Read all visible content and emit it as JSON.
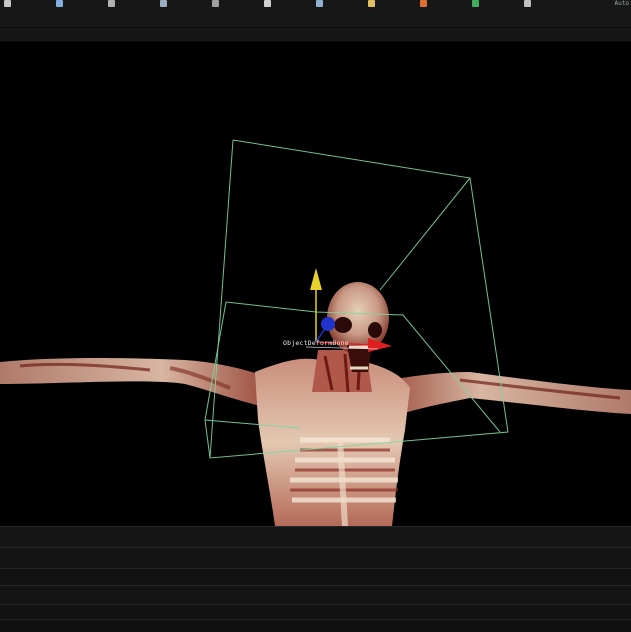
{
  "toolbar": {
    "right_label": "Auto",
    "buttons": [
      {
        "name": "select-tool-button",
        "icon": "arrow-icon",
        "color": "#c8c8c8"
      },
      {
        "name": "move-tool-button",
        "icon": "move-icon",
        "color": "#7fb0e0"
      },
      {
        "name": "rotate-tool-button",
        "icon": "rotate-icon",
        "color": "#b0b0b0"
      },
      {
        "name": "scale-tool-button",
        "icon": "scale-icon",
        "color": "#9ab0c0"
      },
      {
        "name": "snap-button",
        "icon": "magnet-icon",
        "color": "#a0a0a0"
      },
      {
        "name": "link-button",
        "icon": "link-icon",
        "color": "#d0d0d0"
      },
      {
        "name": "camera-button",
        "icon": "camera-icon",
        "color": "#8fb0d0"
      },
      {
        "name": "light-button",
        "icon": "light-icon",
        "color": "#e0c060"
      },
      {
        "name": "render-button",
        "icon": "render-icon",
        "color": "#e07030"
      },
      {
        "name": "material-button",
        "icon": "sphere-icon",
        "color": "#40b060"
      },
      {
        "name": "settings-button",
        "icon": "gear-icon",
        "color": "#c0c0c0"
      }
    ]
  },
  "viewport": {
    "object_label": "ObjectDeformBone",
    "gizmo_colors": {
      "y": "#e8d12a",
      "x": "#e02020",
      "z": "#2233cc"
    },
    "bbox_color": "#7fd6a0",
    "background": "#000000"
  }
}
